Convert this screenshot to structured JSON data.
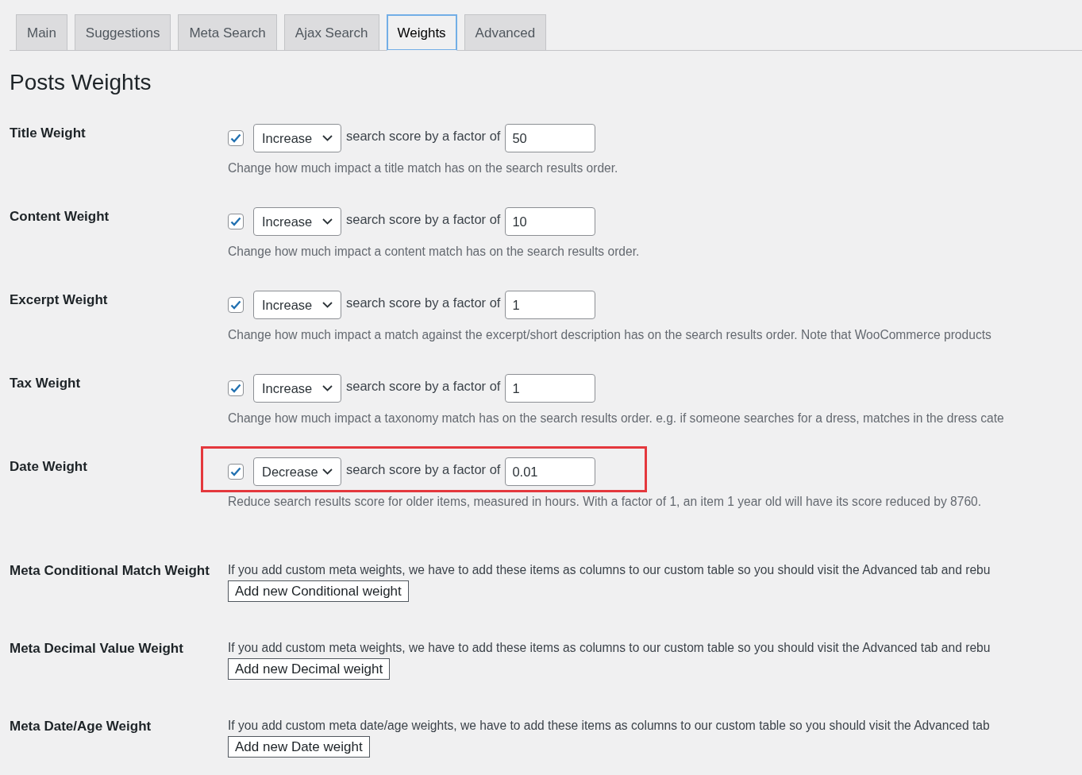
{
  "tabs": [
    {
      "label": "Main",
      "selected": false
    },
    {
      "label": "Suggestions",
      "selected": false
    },
    {
      "label": "Meta Search",
      "selected": false
    },
    {
      "label": "Ajax Search",
      "selected": false
    },
    {
      "label": "Weights",
      "selected": true
    },
    {
      "label": "Advanced",
      "selected": false
    }
  ],
  "heading": "Posts Weights",
  "weights": [
    {
      "label": "Title Weight",
      "checked": true,
      "direction": "Increase",
      "connector": "search score by a factor of",
      "factor": "50",
      "description": "Change how much impact a title match has on the search results order.",
      "highlighted": false
    },
    {
      "label": "Content Weight",
      "checked": true,
      "direction": "Increase",
      "connector": "search score by a factor of",
      "factor": "10",
      "description": "Change how much impact a content match has on the search results order.",
      "highlighted": false
    },
    {
      "label": "Excerpt Weight",
      "checked": true,
      "direction": "Increase",
      "connector": "search score by a factor of",
      "factor": "1",
      "description": "Change how much impact a match against the excerpt/short description has on the search results order. Note that WooCommerce products",
      "highlighted": false
    },
    {
      "label": "Tax Weight",
      "checked": true,
      "direction": "Increase",
      "connector": "search score by a factor of",
      "factor": "1",
      "description": "Change how much impact a taxonomy match has on the search results order. e.g. if someone searches for a dress, matches in the dress cate",
      "highlighted": false
    },
    {
      "label": "Date Weight",
      "checked": true,
      "direction": "Decrease",
      "connector": "search score by a factor of",
      "factor": "0.01",
      "description": "Reduce search results score for older items, measured in hours. With a factor of 1, an item 1 year old will have its score reduced by 8760.",
      "highlighted": true
    }
  ],
  "meta_weights": [
    {
      "label": "Meta Conditional Match Weight",
      "description": "If you add custom meta weights, we have to add these items as columns to our custom table so you should visit the Advanced tab and rebu",
      "button": "Add new Conditional weight"
    },
    {
      "label": "Meta Decimal Value Weight",
      "description": "If you add custom meta weights, we have to add these items as columns to our custom table so you should visit the Advanced tab and rebu",
      "button": "Add new Decimal weight"
    },
    {
      "label": "Meta Date/Age Weight",
      "description": "If you add custom meta date/age weights, we have to add these items as columns to our custom table so you should visit the Advanced tab",
      "button": "Add new Date weight"
    }
  ]
}
